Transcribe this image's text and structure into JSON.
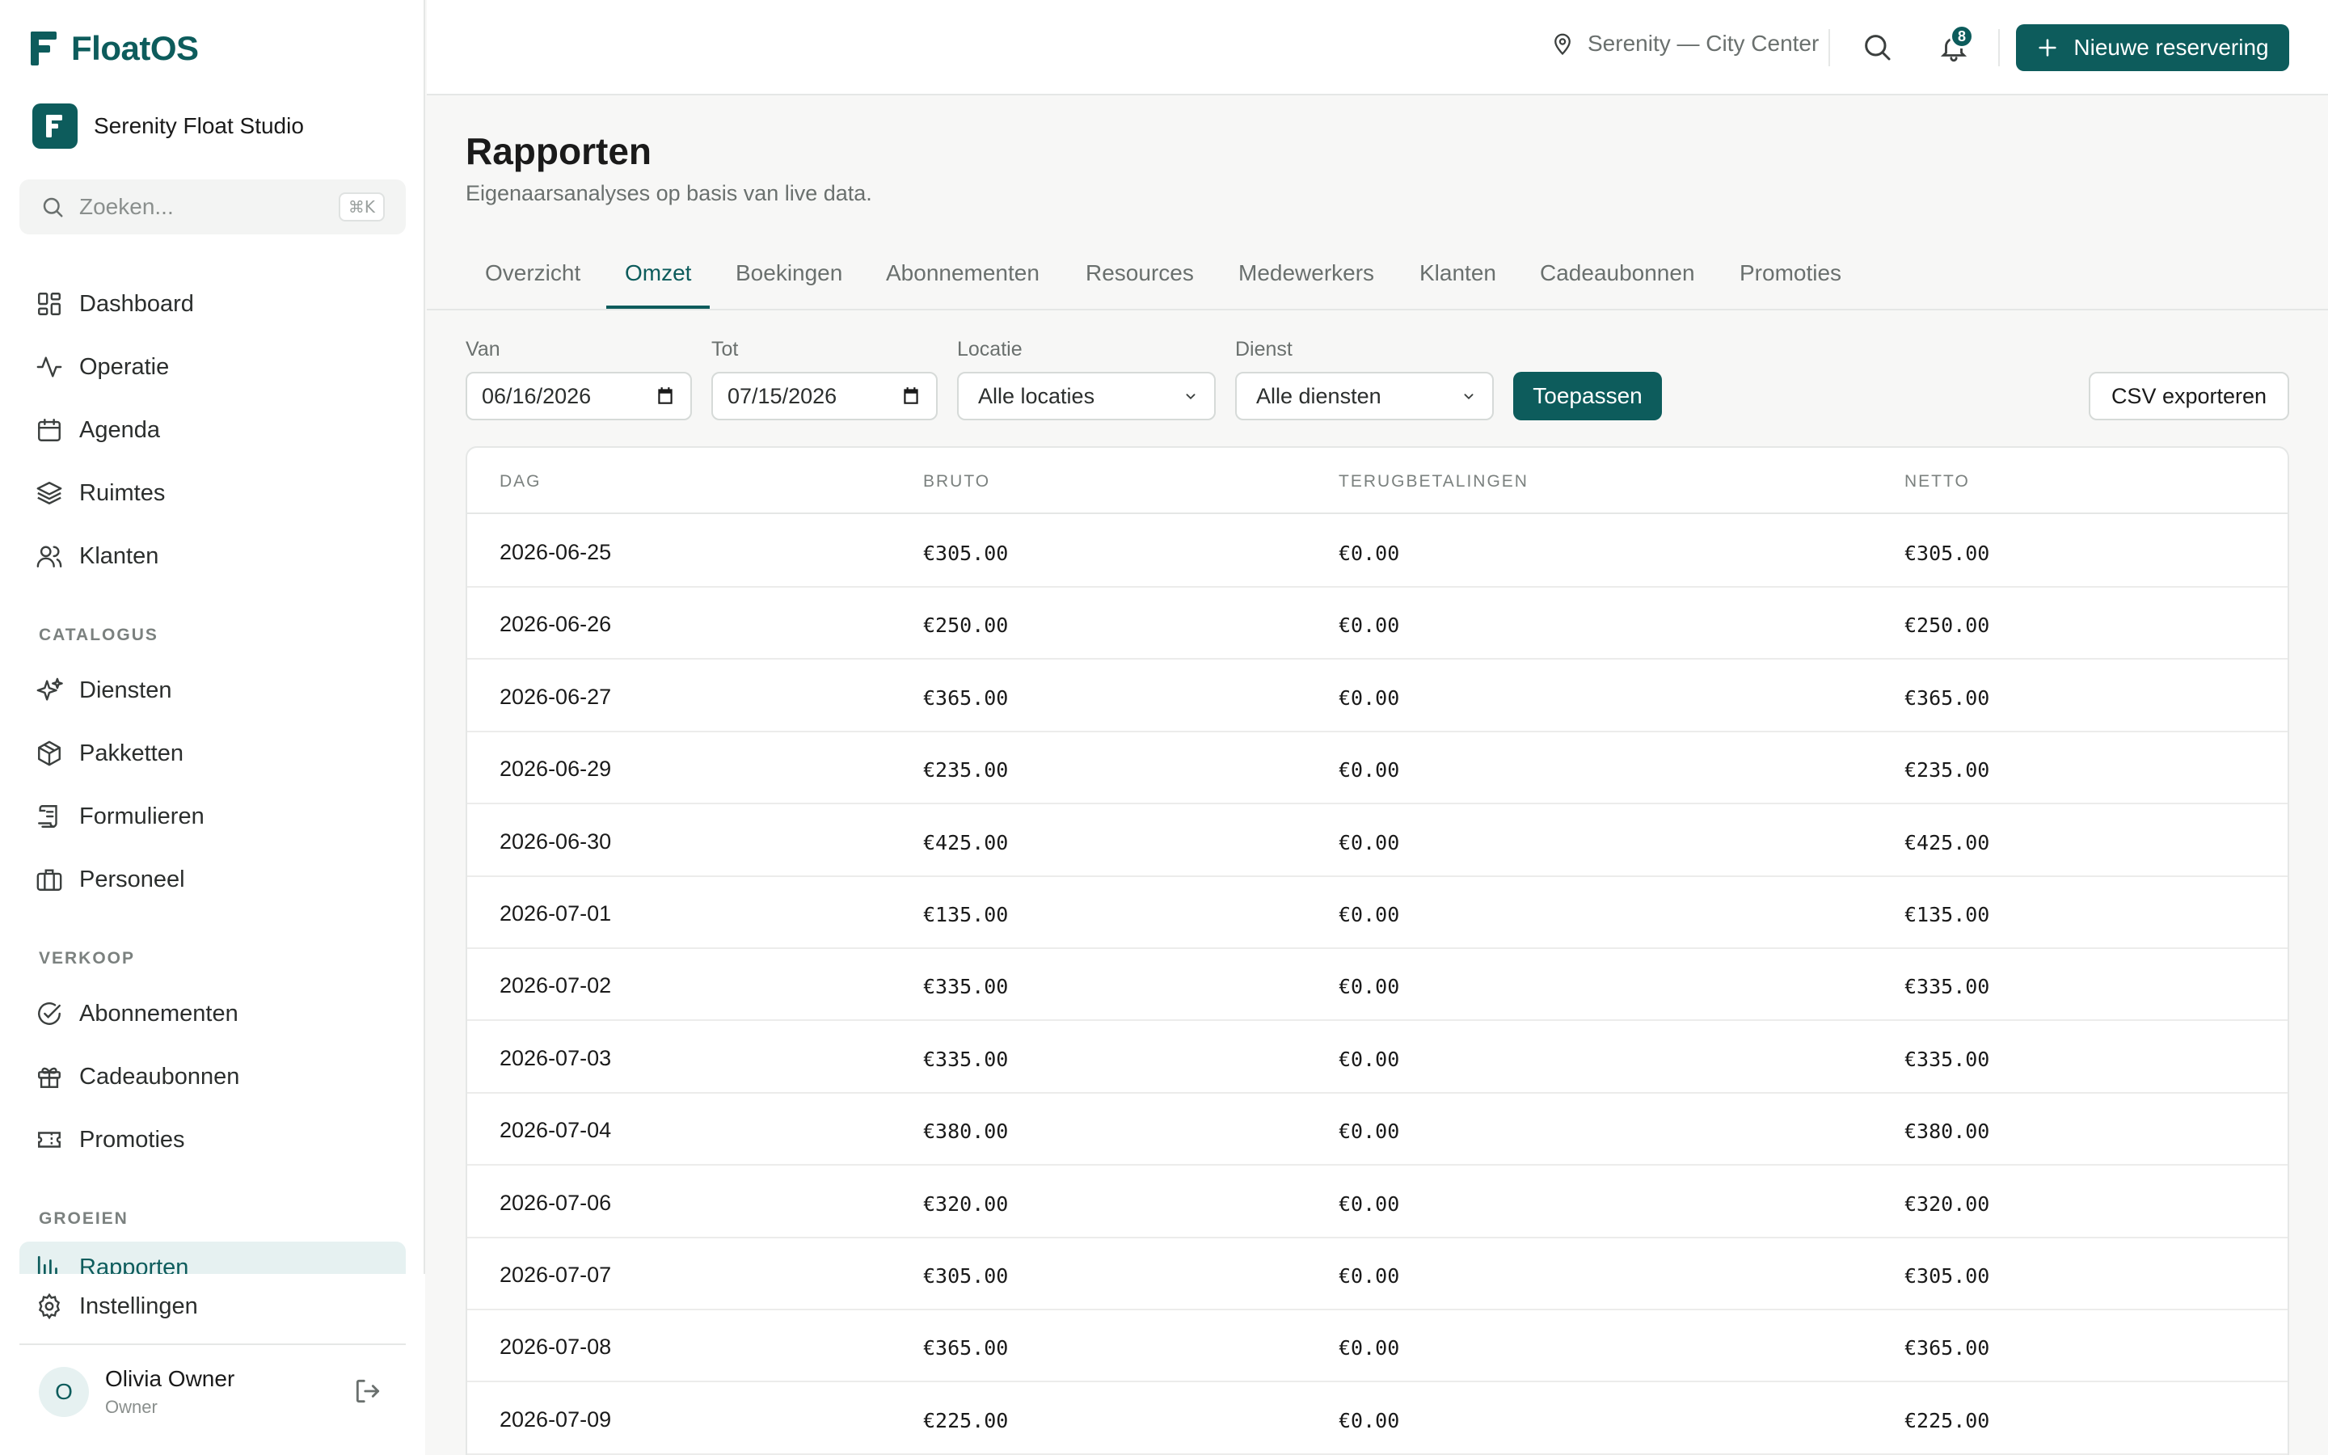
{
  "app": {
    "name": "FloatOS",
    "studio": "Serenity Float Studio",
    "studio_initial": "F"
  },
  "search": {
    "placeholder": "Zoeken...",
    "shortcut": "⌘K"
  },
  "nav": {
    "main": [
      {
        "label": "Dashboard",
        "icon": "dashboard-icon"
      },
      {
        "label": "Operatie",
        "icon": "activity-icon"
      },
      {
        "label": "Agenda",
        "icon": "calendar-icon"
      },
      {
        "label": "Ruimtes",
        "icon": "layers-icon"
      },
      {
        "label": "Klanten",
        "icon": "users-icon"
      }
    ],
    "catalogus_title": "CATALOGUS",
    "catalogus": [
      {
        "label": "Diensten",
        "icon": "sparkles-icon"
      },
      {
        "label": "Pakketten",
        "icon": "package-icon"
      },
      {
        "label": "Formulieren",
        "icon": "scroll-icon"
      },
      {
        "label": "Personeel",
        "icon": "briefcase-icon"
      }
    ],
    "verkoop_title": "VERKOOP",
    "verkoop": [
      {
        "label": "Abonnementen",
        "icon": "check-circle-icon"
      },
      {
        "label": "Cadeaubonnen",
        "icon": "gift-icon"
      },
      {
        "label": "Promoties",
        "icon": "ticket-icon"
      }
    ],
    "groeien_title": "GROEIEN",
    "groeien": [
      {
        "label": "Rapporten",
        "icon": "bar-chart-icon",
        "active": true
      }
    ],
    "settings": {
      "label": "Instellingen",
      "icon": "gear-icon"
    }
  },
  "user": {
    "name": "Olivia Owner",
    "role": "Owner",
    "initial": "O"
  },
  "topbar": {
    "location": "Serenity — City Center",
    "notifications": "8",
    "new_button": "Nieuwe reservering"
  },
  "page": {
    "title": "Rapporten",
    "subtitle": "Eigenaarsanalyses op basis van live data."
  },
  "tabs": [
    "Overzicht",
    "Omzet",
    "Boekingen",
    "Abonnementen",
    "Resources",
    "Medewerkers",
    "Klanten",
    "Cadeaubonnen",
    "Promoties"
  ],
  "active_tab": "Omzet",
  "filters": {
    "van_label": "Van",
    "van_value": "06/16/2026",
    "tot_label": "Tot",
    "tot_value": "07/15/2026",
    "locatie_label": "Locatie",
    "locatie_value": "Alle locaties",
    "dienst_label": "Dienst",
    "dienst_value": "Alle diensten",
    "apply": "Toepassen",
    "export": "CSV exporteren"
  },
  "table": {
    "columns": [
      "DAG",
      "BRUTO",
      "TERUGBETALINGEN",
      "NETTO"
    ],
    "rows": [
      [
        "2026-06-25",
        "€305.00",
        "€0.00",
        "€305.00"
      ],
      [
        "2026-06-26",
        "€250.00",
        "€0.00",
        "€250.00"
      ],
      [
        "2026-06-27",
        "€365.00",
        "€0.00",
        "€365.00"
      ],
      [
        "2026-06-29",
        "€235.00",
        "€0.00",
        "€235.00"
      ],
      [
        "2026-06-30",
        "€425.00",
        "€0.00",
        "€425.00"
      ],
      [
        "2026-07-01",
        "€135.00",
        "€0.00",
        "€135.00"
      ],
      [
        "2026-07-02",
        "€335.00",
        "€0.00",
        "€335.00"
      ],
      [
        "2026-07-03",
        "€335.00",
        "€0.00",
        "€335.00"
      ],
      [
        "2026-07-04",
        "€380.00",
        "€0.00",
        "€380.00"
      ],
      [
        "2026-07-06",
        "€320.00",
        "€0.00",
        "€320.00"
      ],
      [
        "2026-07-07",
        "€305.00",
        "€0.00",
        "€305.00"
      ],
      [
        "2026-07-08",
        "€365.00",
        "€0.00",
        "€365.00"
      ],
      [
        "2026-07-09",
        "€225.00",
        "€0.00",
        "€225.00"
      ]
    ]
  },
  "colors": {
    "brand": "#0d5c5c",
    "active_bg": "#e6f1f1"
  }
}
